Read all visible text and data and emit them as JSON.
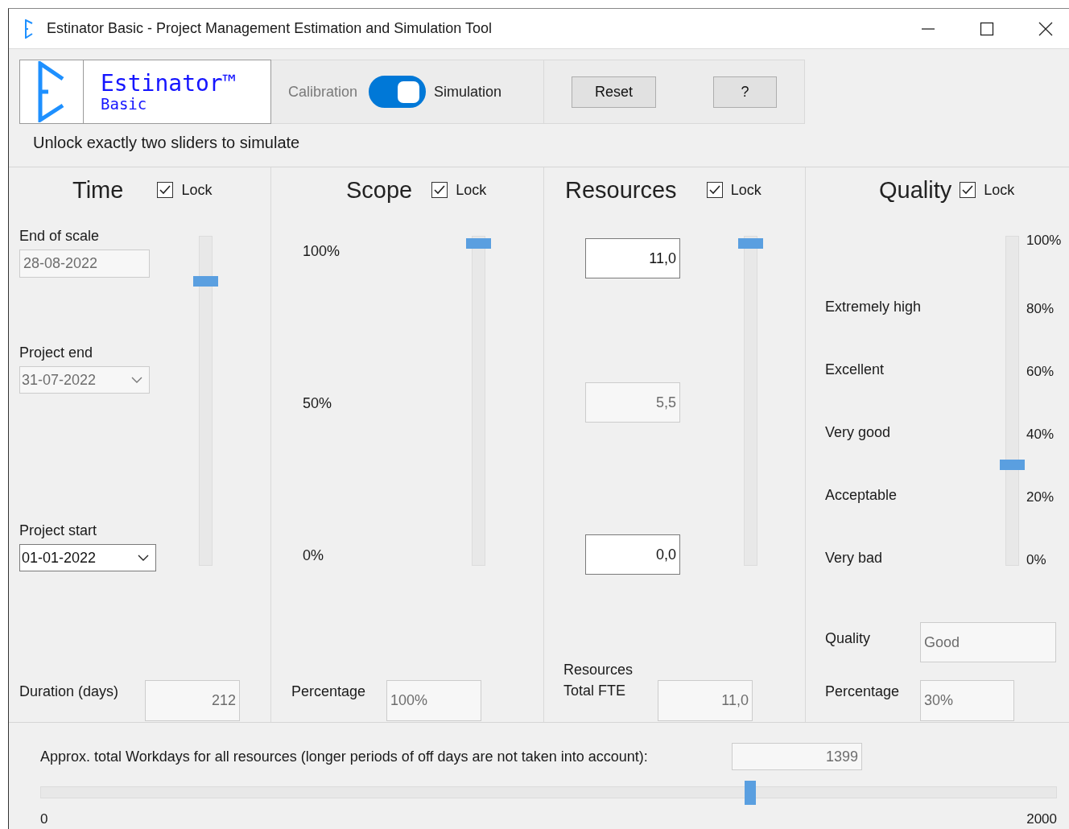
{
  "window": {
    "title": "Estinator Basic - Project Management Estimation and Simulation Tool"
  },
  "logo": {
    "name": "Estinator™",
    "edition": "Basic"
  },
  "mode_toggle": {
    "off_label": "Calibration",
    "on_label": "Simulation",
    "on": true
  },
  "buttons": [
    "Reset",
    "?"
  ],
  "hint": "Unlock exactly two sliders to simulate",
  "time": {
    "title": "Time",
    "lock_label": "Lock",
    "locked": true,
    "fields": [
      {
        "kind": "text",
        "label": "End of scale",
        "value": "28-08-2022",
        "disabled": true
      },
      {
        "kind": "dropdown",
        "label": "Project end",
        "value": "31-07-2022",
        "disabled": true
      },
      {
        "kind": "dropdown",
        "label": "Project start",
        "value": "01-01-2022",
        "disabled": false
      }
    ],
    "slider": {
      "level": 0.88
    },
    "duration": {
      "label": "Duration (days)",
      "value": "212",
      "disabled": true
    }
  },
  "scope": {
    "title": "Scope",
    "lock_label": "Lock",
    "locked": true,
    "ticks": [
      "100%",
      "50%",
      "0%"
    ],
    "slider": {
      "level": 1
    },
    "percentage": {
      "label": "Percentage",
      "value": "100%",
      "disabled": true
    }
  },
  "resources": {
    "title": "Resources",
    "lock_label": "Lock",
    "locked": true,
    "inputs": [
      {
        "value": "11,0",
        "disabled": false
      },
      {
        "value": "5,5",
        "disabled": true
      },
      {
        "value": "0,0",
        "disabled": false
      }
    ],
    "slider": {
      "level": 1
    },
    "total": {
      "label": "Resources Total FTE",
      "value": "11,0",
      "disabled": true
    }
  },
  "quality": {
    "title": "Quality",
    "lock_label": "Lock",
    "locked": true,
    "levels": [
      "Extremely high",
      "Excellent",
      "Very good",
      "Acceptable",
      "Very bad"
    ],
    "slider": {
      "level": 0.3
    },
    "ticks": [
      "100%",
      "80%",
      "60%",
      "40%",
      "20%",
      "0%"
    ],
    "outputs": [
      {
        "label": "Quality",
        "value": "Good",
        "disabled": true
      },
      {
        "label": "Percentage",
        "value": "30%",
        "disabled": true
      }
    ]
  },
  "workdays": {
    "label": "Approx. total Workdays for all resources (longer periods of off days are not taken into account):",
    "value": "1399",
    "disabled": true,
    "slider": {
      "level": 0.7
    },
    "min_label": "0",
    "max_label": "2000"
  }
}
